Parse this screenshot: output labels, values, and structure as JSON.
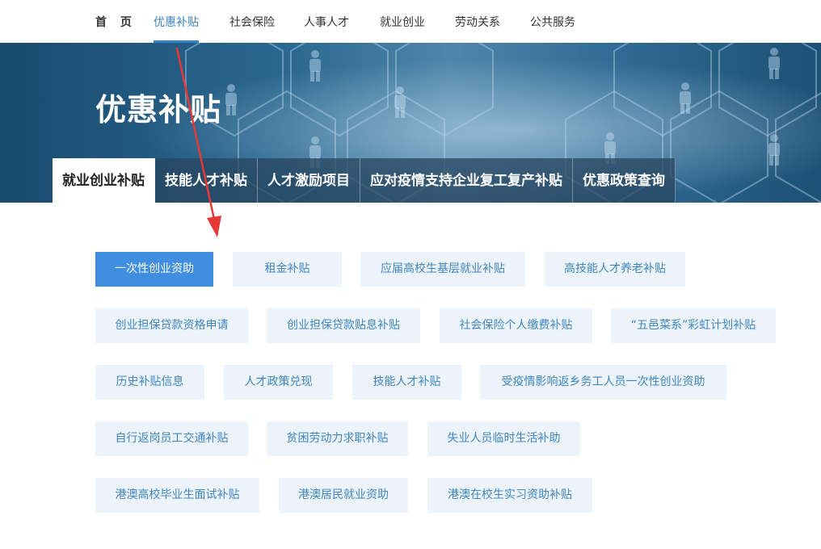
{
  "nav": {
    "items": [
      {
        "label": "首 页"
      },
      {
        "label": "优惠补贴"
      },
      {
        "label": "社会保险"
      },
      {
        "label": "人事人才"
      },
      {
        "label": "就业创业"
      },
      {
        "label": "劳动关系"
      },
      {
        "label": "公共服务"
      }
    ],
    "active_index": 1
  },
  "banner": {
    "title": "优惠补贴",
    "tabs": [
      {
        "label": "就业创业补贴"
      },
      {
        "label": "技能人才补贴"
      },
      {
        "label": "人才激励项目"
      },
      {
        "label": "应对疫情支持企业复工复产补贴"
      },
      {
        "label": "优惠政策查询"
      }
    ],
    "active_tab": 0
  },
  "subsidies": [
    {
      "label": "一次性创业资助"
    },
    {
      "label": "租金补贴"
    },
    {
      "label": "应届高校生基层就业补贴"
    },
    {
      "label": "高技能人才养老补贴"
    },
    {
      "label": "创业担保贷款资格申请"
    },
    {
      "label": "创业担保贷款贴息补贴"
    },
    {
      "label": "社会保险个人缴费补贴"
    },
    {
      "label": "“五邑菜系”彩虹计划补贴"
    },
    {
      "label": "历史补贴信息"
    },
    {
      "label": "人才政策兑现"
    },
    {
      "label": "技能人才补贴"
    },
    {
      "label": "受疫情影响返乡务工人员一次性创业资助"
    },
    {
      "label": "自行返岗员工交通补贴"
    },
    {
      "label": "贫困劳动力求职补贴"
    },
    {
      "label": "失业人员临时生活补助"
    },
    {
      "label": "港澳高校毕业生面试补贴"
    },
    {
      "label": "港澳居民就业资助"
    },
    {
      "label": "港澳在校生实习资助补贴"
    }
  ],
  "colors": {
    "accent": "#3b82c4",
    "chip_bg": "#ecf3fb",
    "chip_text": "#3f86c0",
    "chip_active": "#3f8ee0",
    "arrow": "#e53935"
  }
}
